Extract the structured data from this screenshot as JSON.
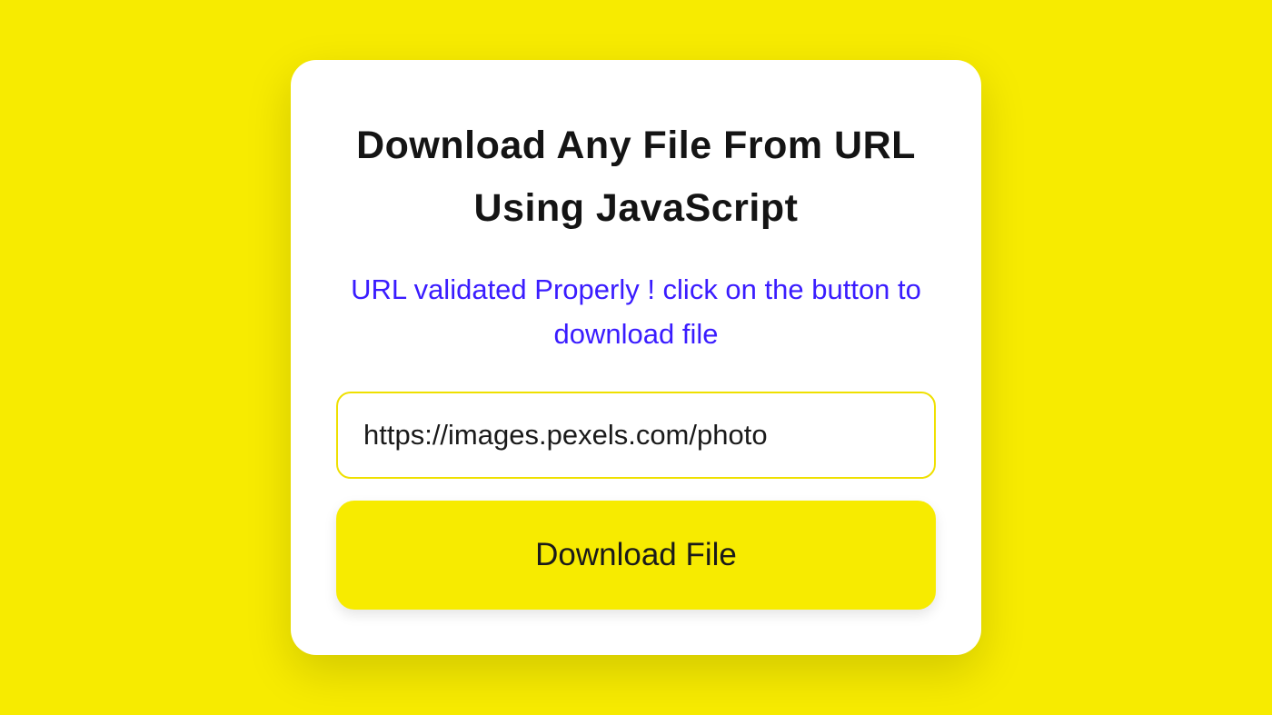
{
  "card": {
    "title": "Download Any File From URL Using JavaScript",
    "status_message": "URL validated Properly ! click on the button to download file",
    "url_input_value": "https://images.pexels.com/photo",
    "download_button_label": "Download File"
  }
}
